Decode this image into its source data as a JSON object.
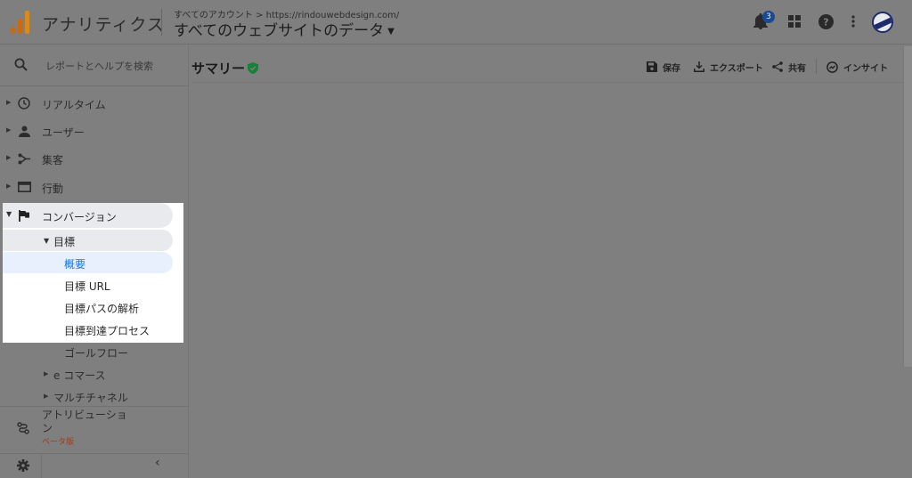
{
  "header": {
    "app_title": "アナリティクス",
    "breadcrumb": "すべてのアカウント > https://rindouwebdesign.com/",
    "view_title": "すべてのウェブサイトのデータ",
    "notification_count": "3",
    "icons": [
      "bell-icon",
      "apps-grid-icon",
      "help-icon",
      "more-vert-icon",
      "avatar"
    ]
  },
  "sidebar": {
    "search_placeholder": "レポートとヘルプを検索",
    "items": [
      {
        "label": "リアルタイム",
        "icon": "clock-icon"
      },
      {
        "label": "ユーザー",
        "icon": "person-icon"
      },
      {
        "label": "集客",
        "icon": "acquisition-icon"
      },
      {
        "label": "行動",
        "icon": "behavior-icon"
      },
      {
        "label": "コンバージョン",
        "icon": "flag-icon"
      }
    ],
    "goals": {
      "label": "目標",
      "children": [
        "概要",
        "目標 URL",
        "目標パスの解析",
        "目標到達プロセス",
        "ゴールフロー"
      ]
    },
    "ecommerce_label": "e コマース",
    "multichannel_label": "マルチチャネル",
    "attribution_label": "アトリビューション",
    "beta_label": "ベータ版",
    "collapse_glyph": "‹"
  },
  "main": {
    "title": "サマリー",
    "toolbar": {
      "save": "保存",
      "export": "エクスポート",
      "share": "共有",
      "insights": "インサイト"
    }
  },
  "colors": {
    "overlay": "#7f7f7f",
    "active_blue": "#1a73e8",
    "verified_green": "#188038",
    "beta_orange": "#a33a18"
  }
}
